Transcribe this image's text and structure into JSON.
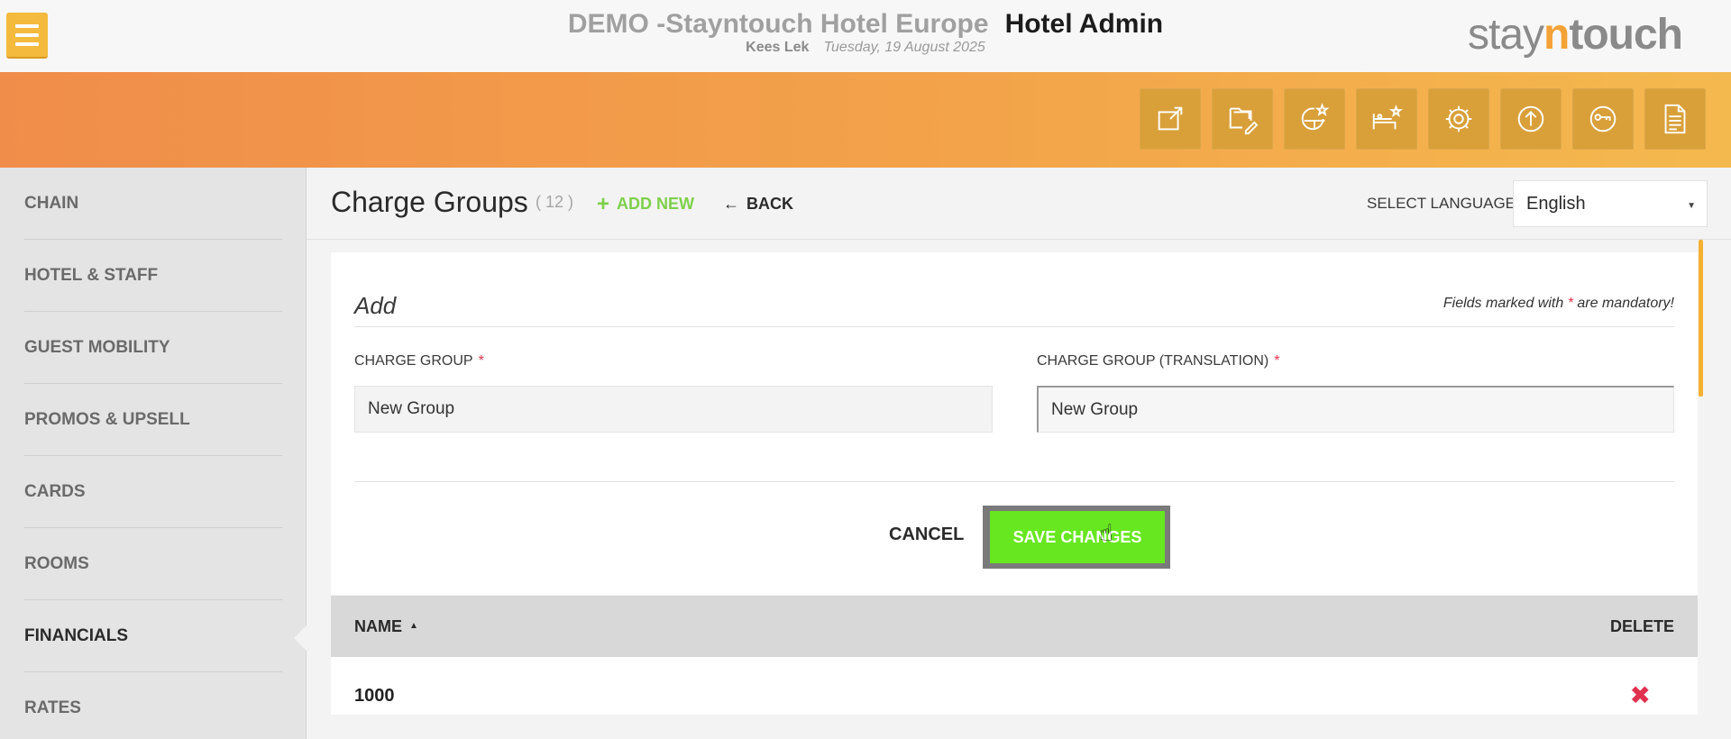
{
  "header": {
    "hotel_name": "DEMO -Stayntouch Hotel Europe",
    "app_name": "Hotel Admin",
    "user_name": "Kees Lek",
    "date": "Tuesday, 19 August 2025",
    "logo_parts": [
      "stay",
      "n",
      "touch"
    ]
  },
  "toolbar_icons": [
    "external-link-icon",
    "folder-edit-icon",
    "chart-star-icon",
    "bed-star-icon",
    "gear-icon",
    "upload-icon",
    "key-icon",
    "document-icon"
  ],
  "sidebar": {
    "items": [
      {
        "label": "CHAIN"
      },
      {
        "label": "HOTEL & STAFF"
      },
      {
        "label": "GUEST MOBILITY"
      },
      {
        "label": "PROMOS & UPSELL"
      },
      {
        "label": "CARDS"
      },
      {
        "label": "ROOMS"
      },
      {
        "label": "FINANCIALS",
        "active": true
      },
      {
        "label": "RATES"
      }
    ]
  },
  "page": {
    "title": "Charge Groups",
    "count": "( 12 )",
    "add_new": "ADD NEW",
    "back": "BACK",
    "language_label": "SELECT LANGUAGE",
    "language_value": "English"
  },
  "form": {
    "title": "Add",
    "mandatory_prefix": "Fields marked with",
    "mandatory_star": "*",
    "mandatory_suffix": "are mandatory!",
    "charge_group_label": "CHARGE GROUP",
    "charge_group_value": "New Group",
    "translation_label": "CHARGE GROUP (TRANSLATION)",
    "translation_value": "New Group",
    "cancel": "CANCEL",
    "save": "SAVE CHANGES"
  },
  "list": {
    "col_name": "NAME",
    "col_delete": "DELETE",
    "rows": [
      {
        "name": "1000"
      }
    ]
  },
  "colors": {
    "accent_orange": "#f4a236",
    "save_green": "#67e71f",
    "add_green": "#7ed04a",
    "delete_red": "#e0314e"
  }
}
